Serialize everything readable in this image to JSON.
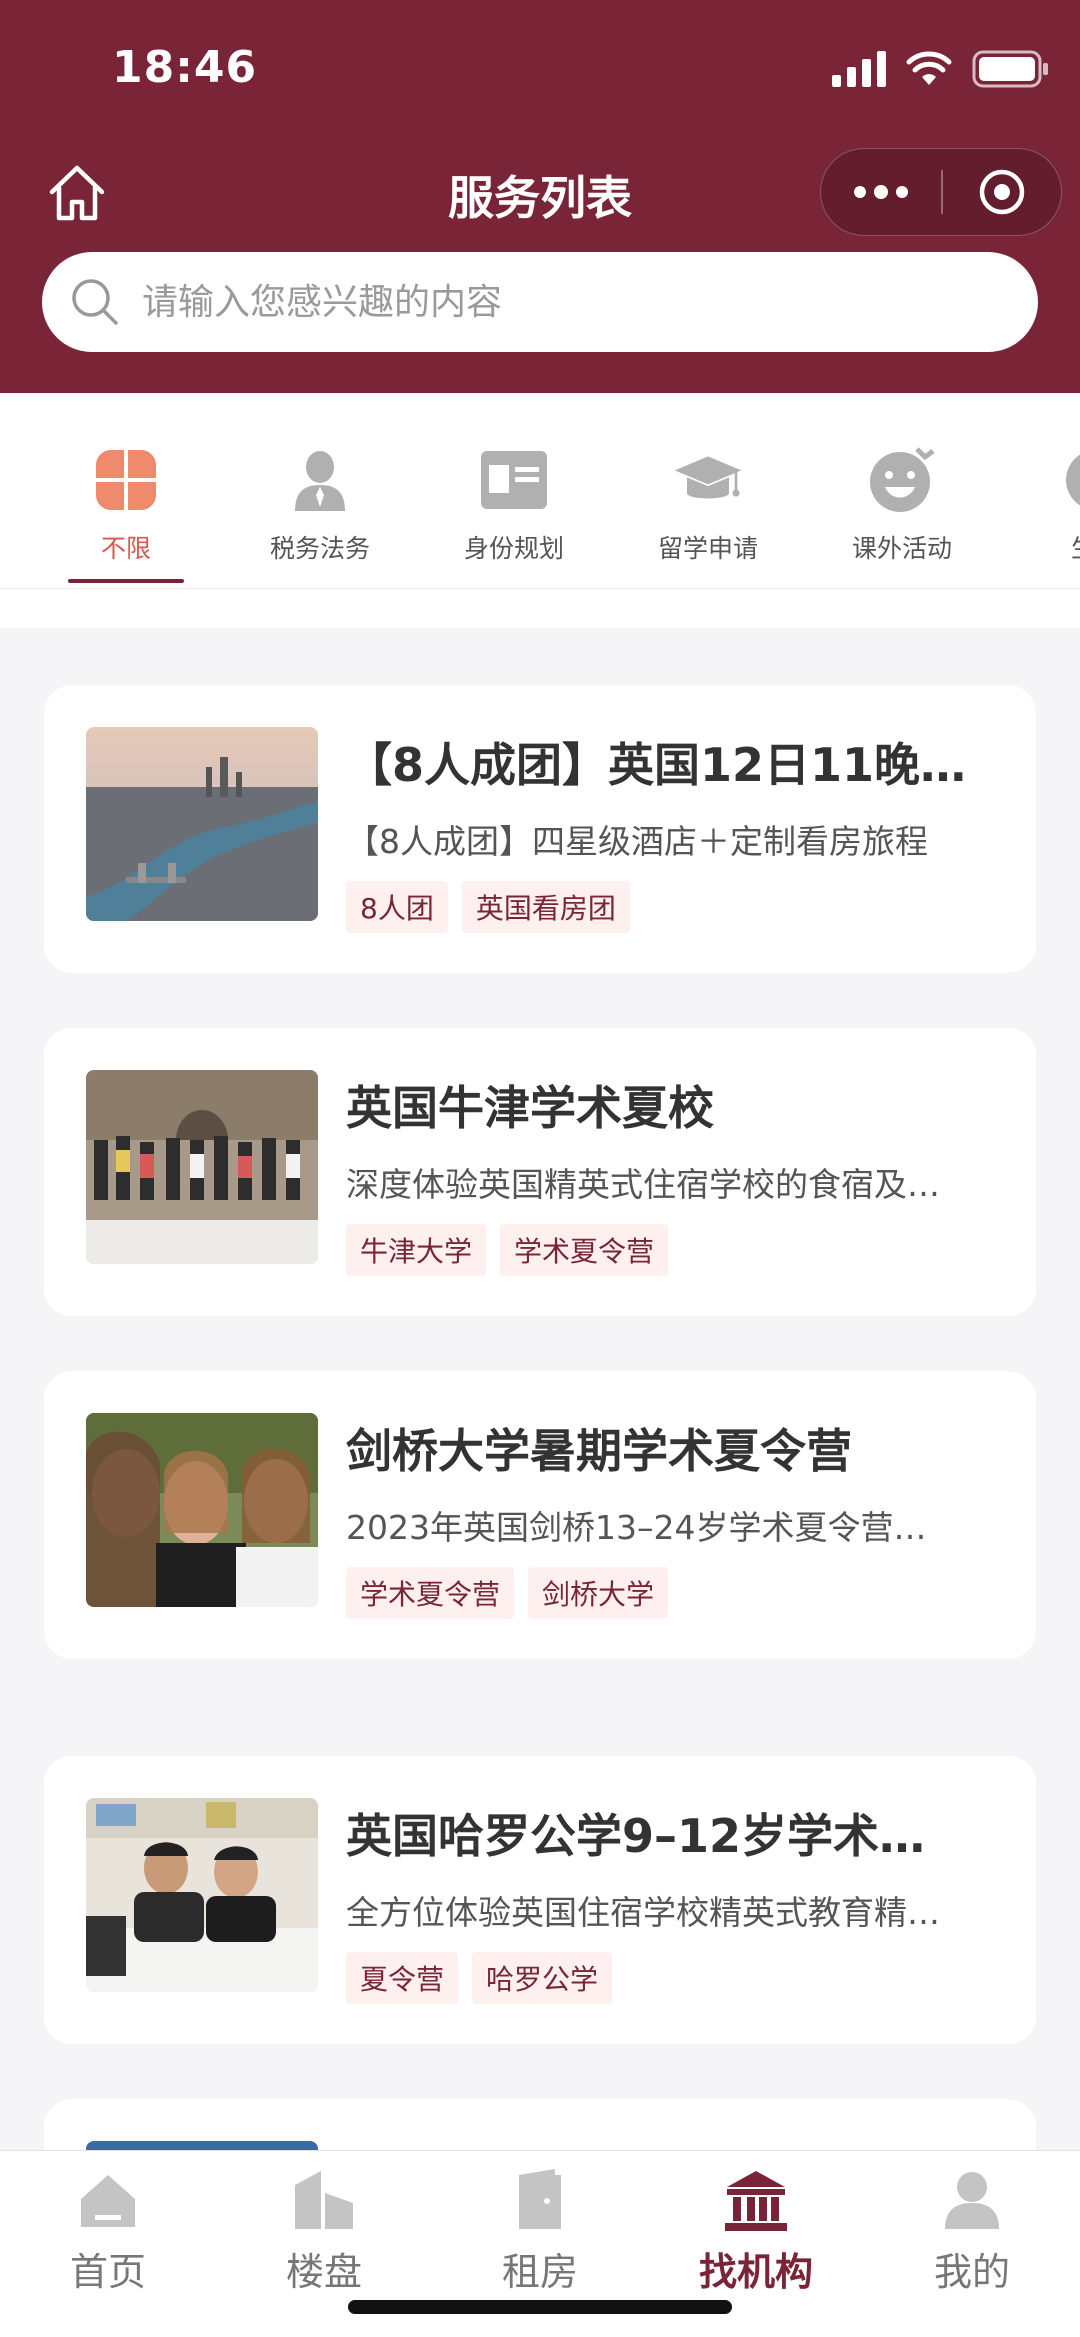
{
  "status_bar": {
    "time": "18:46"
  },
  "header": {
    "title": "服务列表"
  },
  "search": {
    "placeholder": "请输入您感兴趣的内容",
    "value": ""
  },
  "categories": [
    {
      "label": "不限",
      "icon": "grid-flower-icon",
      "active": true
    },
    {
      "label": "税务法务",
      "icon": "person-icon"
    },
    {
      "label": "身份规划",
      "icon": "id-card-icon"
    },
    {
      "label": "留学申请",
      "icon": "graduation-cap-icon"
    },
    {
      "label": "课外活动",
      "icon": "smiley-icon"
    },
    {
      "label": "生活",
      "icon": "partial-icon"
    }
  ],
  "cards": [
    {
      "title": "【8人成团】英国12日11晚…",
      "desc": "【8人成团】四星级酒店＋定制看房旅程",
      "tags": [
        "8人团",
        "英国看房团"
      ]
    },
    {
      "title": "英国牛津学术夏校",
      "desc": "深度体验英国精英式住宿学校的食宿及…",
      "tags": [
        "牛津大学",
        "学术夏令营"
      ]
    },
    {
      "title": "剑桥大学暑期学术夏令营",
      "desc": "2023年英国剑桥13–24岁学术夏令营…",
      "tags": [
        "学术夏令营",
        "剑桥大学"
      ]
    },
    {
      "title": "英国哈罗公学9–12岁学术…",
      "desc": "全方位体验英国住宿学校精英式教育精…",
      "tags": [
        "夏令营",
        "哈罗公学"
      ]
    }
  ],
  "tabbar": [
    {
      "label": "首页",
      "icon": "home-icon"
    },
    {
      "label": "楼盘",
      "icon": "buildings-icon"
    },
    {
      "label": "租房",
      "icon": "door-icon"
    },
    {
      "label": "找机构",
      "icon": "institution-icon",
      "active": true
    },
    {
      "label": "我的",
      "icon": "profile-icon"
    }
  ],
  "colors": {
    "brand": "#7a2438",
    "active_category": "#d9574f",
    "tag_bg": "#fdf0ef"
  }
}
